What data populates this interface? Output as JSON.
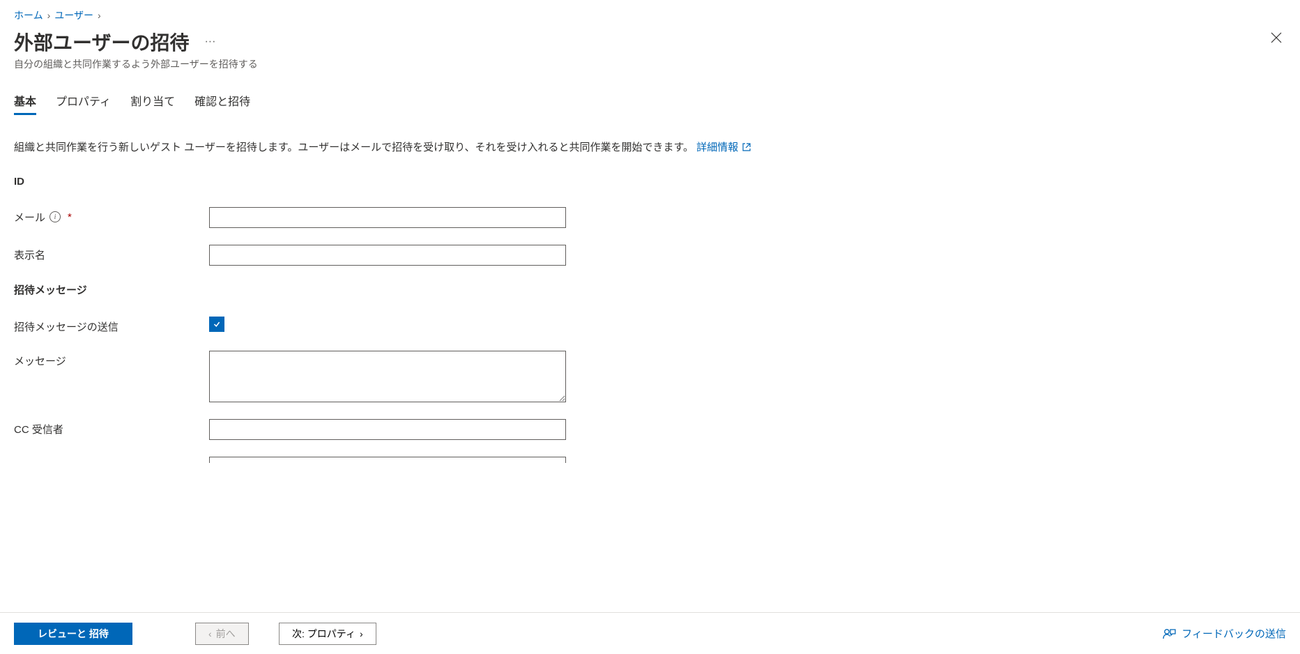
{
  "breadcrumb": {
    "home": "ホーム",
    "users": "ユーザー"
  },
  "header": {
    "title": "外部ユーザーの招待",
    "subtitle": "自分の組織と共同作業するよう外部ユーザーを招待する"
  },
  "tabs": {
    "basic": "基本",
    "properties": "プロパティ",
    "assignments": "割り当て",
    "review": "確認と招待"
  },
  "description": {
    "text": "組織と共同作業を行う新しいゲスト ユーザーを招待します。ユーザーはメールで招待を受け取り、それを受け入れると共同作業を開始できます。",
    "link": "詳細情報"
  },
  "sections": {
    "id": "ID",
    "invite_message": "招待メッセージ"
  },
  "fields": {
    "email_label": "メール",
    "display_name_label": "表示名",
    "send_message_label": "招待メッセージの送信",
    "message_label": "メッセージ",
    "cc_label": "CC 受信者"
  },
  "footer": {
    "review_invite": "レビューと 招待",
    "prev": "前へ",
    "next": "次: プロパティ",
    "feedback": "フィードバックの送信"
  }
}
